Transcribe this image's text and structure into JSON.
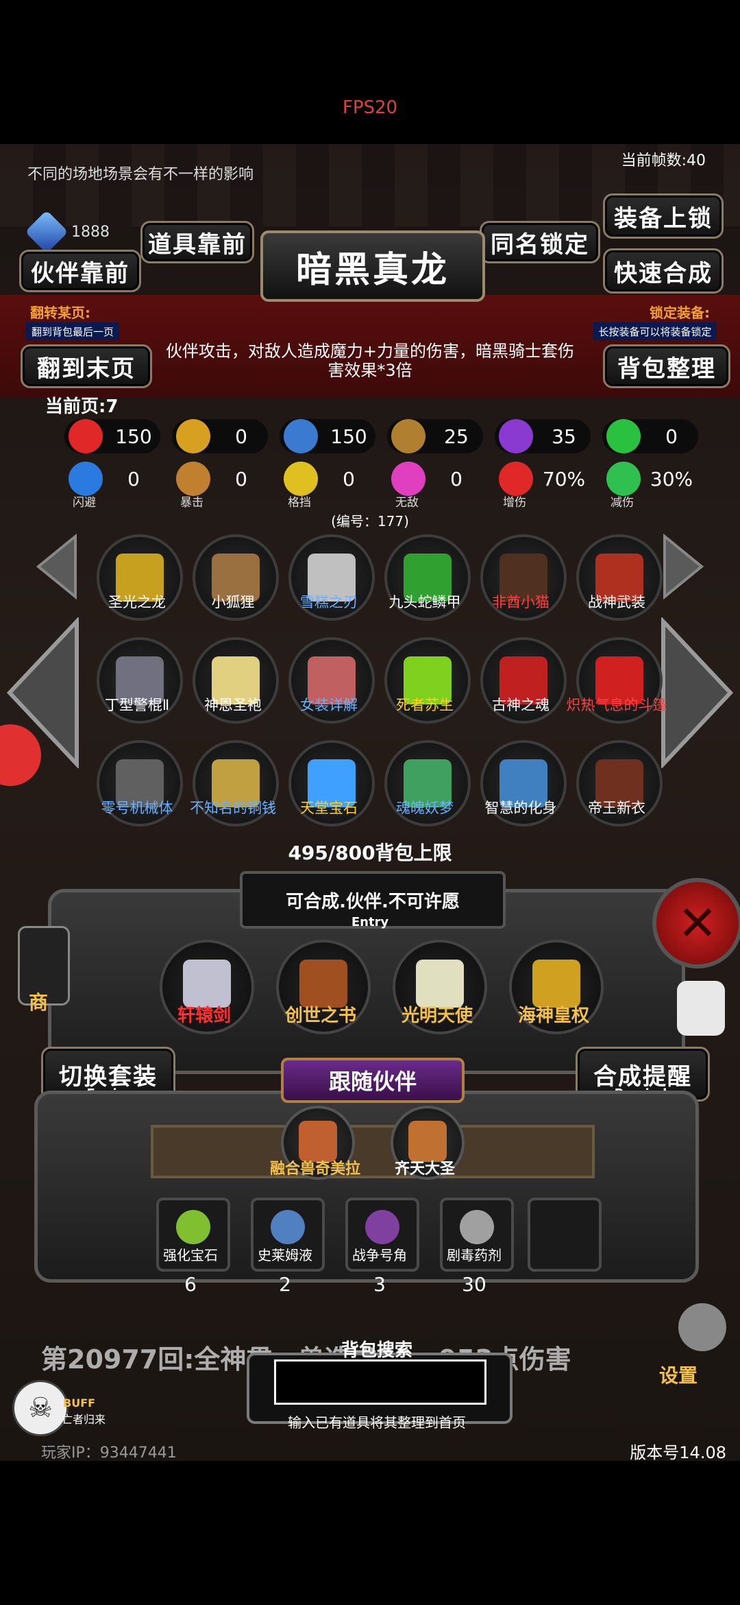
{
  "fps": "FPS20",
  "scene_hint": "不同的场地场景会有不一样的影响",
  "current_fps": "当前帧数:40",
  "gems": "1888",
  "buttons": {
    "items_front": "道具靠前",
    "partners_front": "伙伴靠前",
    "same_name_lock": "同名锁定",
    "equip_lock": "装备上锁",
    "quick_merge": "快速合成",
    "to_last_page": "翻到末页",
    "sort_bag": "背包整理",
    "switch_set": "切换套装",
    "switch_set_sub": "Equip",
    "merge_remind": "合成提醒",
    "merge_remind_sub": "Remind",
    "follow_partner": "跟随伙伴"
  },
  "item_title": "暗黑真龙",
  "flip_page_label": "翻转某页:",
  "flip_page_hint": "翻到背包最后一页",
  "lock_equip_label": "锁定装备:",
  "lock_equip_hint": "长按装备可以将装备锁定",
  "description": "伙伴攻击，对敌人造成魔力+力量的伤害，暗黑骑士套伤害效果*3倍",
  "current_page": "当前页:7",
  "stats_row1": [
    {
      "icon": "heart-icon",
      "value": "150",
      "color": "#e02828"
    },
    {
      "icon": "muscle-icon",
      "value": "0",
      "color": "#d8a020"
    },
    {
      "icon": "helmet-icon",
      "value": "150",
      "color": "#3a7ad0"
    },
    {
      "icon": "sword-icon",
      "value": "25",
      "color": "#b08030"
    },
    {
      "icon": "lightning-icon",
      "value": "35",
      "color": "#8a3ad0"
    },
    {
      "icon": "clover-icon",
      "value": "0",
      "color": "#2ac040"
    }
  ],
  "stats_row2": [
    {
      "icon": "dodge-icon",
      "value": "0",
      "label": "闪避",
      "color": "#2a7ae0"
    },
    {
      "icon": "crit-icon",
      "value": "0",
      "label": "暴击",
      "color": "#c08030"
    },
    {
      "icon": "block-icon",
      "value": "0",
      "label": "格挡",
      "color": "#e0c020"
    },
    {
      "icon": "invincible-icon",
      "value": "0",
      "label": "无敌",
      "color": "#e040c0"
    },
    {
      "icon": "damage-up-icon",
      "value": "70%",
      "label": "增伤",
      "color": "#e02828"
    },
    {
      "icon": "damage-down-icon",
      "value": "30%",
      "label": "减伤",
      "color": "#30c050"
    }
  ],
  "item_number": "(编号：177)",
  "items": [
    {
      "name": "圣光之龙",
      "color": "#ffffff",
      "art": "#c8a020"
    },
    {
      "name": "小狐狸",
      "color": "#ffffff",
      "art": "#9a7040"
    },
    {
      "name": "雪糕之刃",
      "color": "#6ab0ff",
      "art": "#c0c0c0"
    },
    {
      "name": "九头蛇鳞甲",
      "color": "#ffffff",
      "art": "#30a030"
    },
    {
      "name": "非酋小猫",
      "color": "#ff4040",
      "art": "#503020"
    },
    {
      "name": "战神武装",
      "color": "#ffffff",
      "art": "#b03020"
    },
    {
      "name": "丁型警棍Ⅱ",
      "color": "#ffffff",
      "art": "#707080"
    },
    {
      "name": "神恩圣袍",
      "color": "#ffffff",
      "art": "#e0d080"
    },
    {
      "name": "女装详解",
      "color": "#6ab0ff",
      "art": "#c06060"
    },
    {
      "name": "死者苏生",
      "color": "#ffd020",
      "art": "#80d020"
    },
    {
      "name": "古神之魂",
      "color": "#ffffff",
      "art": "#c02020"
    },
    {
      "name": "炽热气息的斗篷",
      "color": "#ff4040",
      "art": "#d02020"
    },
    {
      "name": "零号机械体",
      "color": "#6ab0ff",
      "art": "#606060"
    },
    {
      "name": "不知名的铜钱",
      "color": "#6ab0ff",
      "art": "#c0a040"
    },
    {
      "name": "天堂宝石",
      "color": "#ffd020",
      "art": "#40a0ff"
    },
    {
      "name": "魂魄妖梦",
      "color": "#6ab0ff",
      "art": "#40a060"
    },
    {
      "name": "智慧的化身",
      "color": "#ffffff",
      "art": "#4080c0"
    },
    {
      "name": "帝王新衣",
      "color": "#ffffff",
      "art": "#703020"
    }
  ],
  "bag_limit": "495/800背包上限",
  "craft_title": "可合成.伙伴.不可许愿",
  "craft_entry": "Entry",
  "craft_items": [
    {
      "name": "轩辕剑",
      "color": "#ff3030"
    },
    {
      "name": "创世之书",
      "color": "#f3c14a"
    },
    {
      "name": "光明天使",
      "color": "#f3c14a"
    },
    {
      "name": "海神皇权",
      "color": "#f3c14a"
    }
  ],
  "side_labels": {
    "shop": "商",
    "settings": "设置"
  },
  "partners": [
    {
      "name": "融合兽奇美拉",
      "color": "#f3c14a"
    },
    {
      "name": "齐天大圣",
      "color": "#ffffff"
    }
  ],
  "potions": [
    {
      "name": "强化宝石",
      "count": "6"
    },
    {
      "name": "史莱姆液",
      "count": "2"
    },
    {
      "name": "战争号角",
      "count": "3"
    },
    {
      "name": "剧毒药剂",
      "count": "30"
    }
  ],
  "battle_log": "第20977回:全神贯…兽造成59…953点伤害",
  "search_title": "背包搜索",
  "search_hint": "输入已有道具将其整理到首页",
  "search_value": "",
  "buff_label": "BUFF",
  "buff_sub": "亡者归来",
  "player_ip": "玩家IP：93447441",
  "version": "版本号14.08"
}
